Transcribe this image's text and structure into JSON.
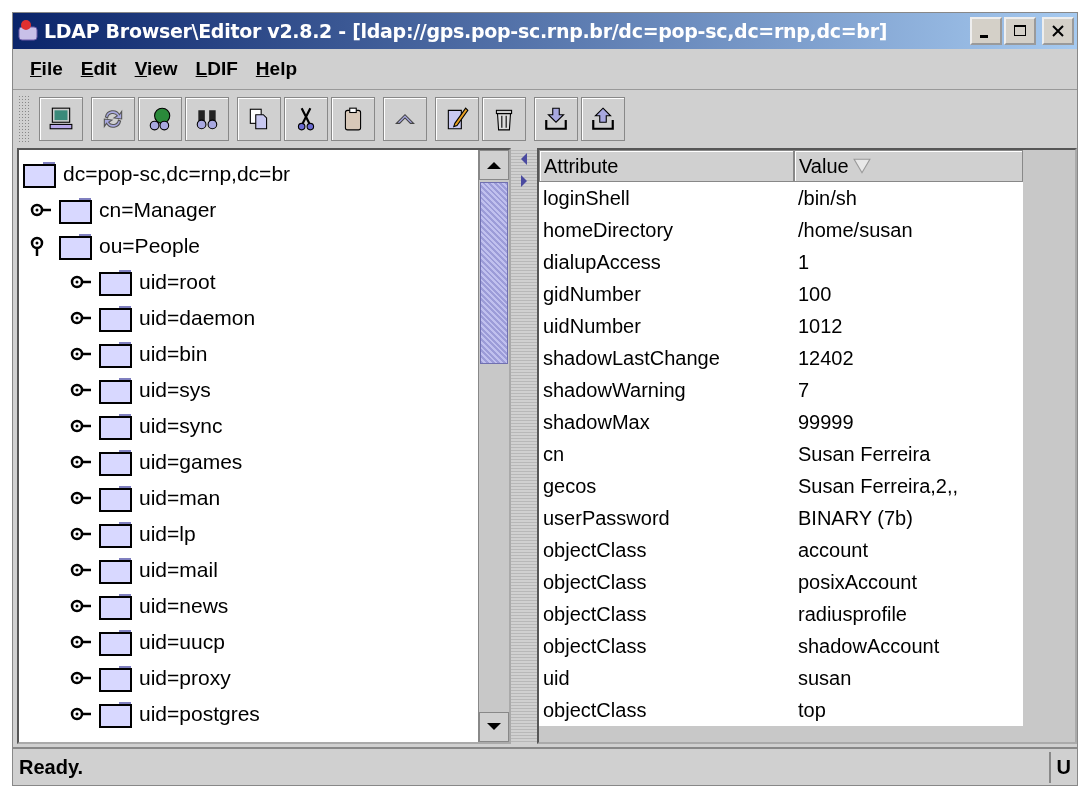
{
  "window": {
    "title": "LDAP Browser\\Editor v2.8.2 - [ldap://gps.pop-sc.rnp.br/dc=pop-sc,dc=rnp,dc=br]"
  },
  "menu": [
    "File",
    "Edit",
    "View",
    "LDIF",
    "Help"
  ],
  "toolbar": [
    [
      {
        "kind": "computer"
      }
    ],
    [
      {
        "kind": "refresh"
      },
      {
        "kind": "globe-search"
      },
      {
        "kind": "binoculars"
      }
    ],
    [
      {
        "kind": "copy"
      },
      {
        "kind": "cut"
      },
      {
        "kind": "paste"
      }
    ],
    [
      {
        "kind": "up"
      }
    ],
    [
      {
        "kind": "edit"
      },
      {
        "kind": "trash"
      }
    ],
    [
      {
        "kind": "import"
      },
      {
        "kind": "export"
      }
    ]
  ],
  "tree": {
    "label": "dc=pop-sc,dc=rnp,dc=br",
    "children": [
      {
        "label": "cn=Manager",
        "expanded": false
      },
      {
        "label": "ou=People",
        "expanded": true,
        "children": [
          {
            "label": "uid=root",
            "expanded": false
          },
          {
            "label": "uid=daemon",
            "expanded": false
          },
          {
            "label": "uid=bin",
            "expanded": false
          },
          {
            "label": "uid=sys",
            "expanded": false
          },
          {
            "label": "uid=sync",
            "expanded": false
          },
          {
            "label": "uid=games",
            "expanded": false
          },
          {
            "label": "uid=man",
            "expanded": false
          },
          {
            "label": "uid=lp",
            "expanded": false
          },
          {
            "label": "uid=mail",
            "expanded": false
          },
          {
            "label": "uid=news",
            "expanded": false
          },
          {
            "label": "uid=uucp",
            "expanded": false
          },
          {
            "label": "uid=proxy",
            "expanded": false
          },
          {
            "label": "uid=postgres",
            "expanded": false
          }
        ]
      }
    ]
  },
  "table": {
    "columns": [
      {
        "label": "Attribute",
        "sorted": false
      },
      {
        "label": "Value",
        "sorted": true
      }
    ],
    "rows": [
      [
        "loginShell",
        "/bin/sh"
      ],
      [
        "homeDirectory",
        "/home/susan"
      ],
      [
        "dialupAccess",
        "1"
      ],
      [
        "gidNumber",
        "100"
      ],
      [
        "uidNumber",
        "1012"
      ],
      [
        "shadowLastChange",
        "12402"
      ],
      [
        "shadowWarning",
        "7"
      ],
      [
        "shadowMax",
        "99999"
      ],
      [
        "cn",
        "Susan Ferreira"
      ],
      [
        "gecos",
        "Susan Ferreira,2,,"
      ],
      [
        "userPassword",
        "BINARY (7b)"
      ],
      [
        "objectClass",
        "account"
      ],
      [
        "objectClass",
        "posixAccount"
      ],
      [
        "objectClass",
        "radiusprofile"
      ],
      [
        "objectClass",
        "shadowAccount"
      ],
      [
        "uid",
        "susan"
      ],
      [
        "objectClass",
        "top"
      ]
    ]
  },
  "status_bar": {
    "message": "Ready.",
    "indicator": "U"
  }
}
